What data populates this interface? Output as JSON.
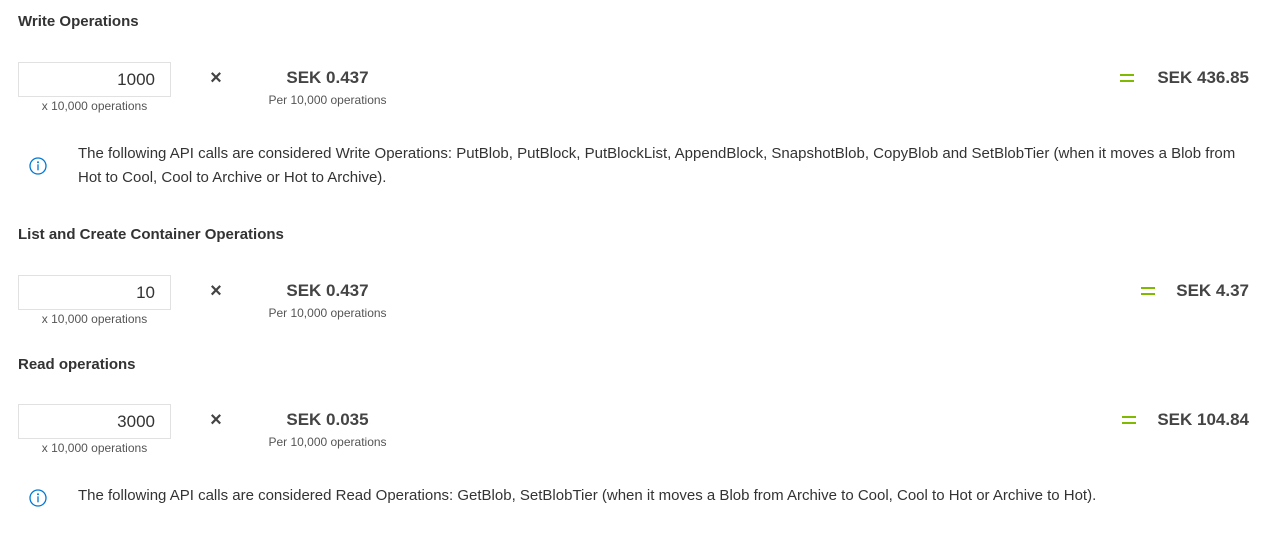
{
  "colors": {
    "accent": "#7fba00",
    "info": "#0078d4",
    "text": "#333333"
  },
  "sections": {
    "write": {
      "title": "Write Operations",
      "quantity": "1000",
      "quantity_unit": "x 10,000 operations",
      "multiply_icon": "times-icon",
      "price": "SEK 0.437",
      "price_unit": "Per 10,000 operations",
      "equals_icon": "equals-icon",
      "total": "SEK 436.85",
      "info_icon": "info-icon",
      "note": "The following API calls are considered Write Operations: PutBlob, PutBlock, PutBlockList, AppendBlock, SnapshotBlob, CopyBlob and SetBlobTier (when it moves a Blob from Hot to Cool, Cool to Archive or Hot to Archive)."
    },
    "list_create": {
      "title": "List and Create Container Operations",
      "quantity": "10",
      "quantity_unit": "x 10,000 operations",
      "multiply_icon": "times-icon",
      "price": "SEK 0.437",
      "price_unit": "Per 10,000 operations",
      "equals_icon": "equals-icon",
      "total": "SEK 4.37"
    },
    "read": {
      "title": "Read operations",
      "quantity": "3000",
      "quantity_unit": "x 10,000 operations",
      "multiply_icon": "times-icon",
      "price": "SEK 0.035",
      "price_unit": "Per 10,000 operations",
      "equals_icon": "equals-icon",
      "total": "SEK 104.84",
      "info_icon": "info-icon",
      "note": "The following API calls are considered Read Operations: GetBlob, SetBlobTier (when it moves a Blob from Archive to Cool, Cool to Hot or Archive to Hot)."
    }
  }
}
